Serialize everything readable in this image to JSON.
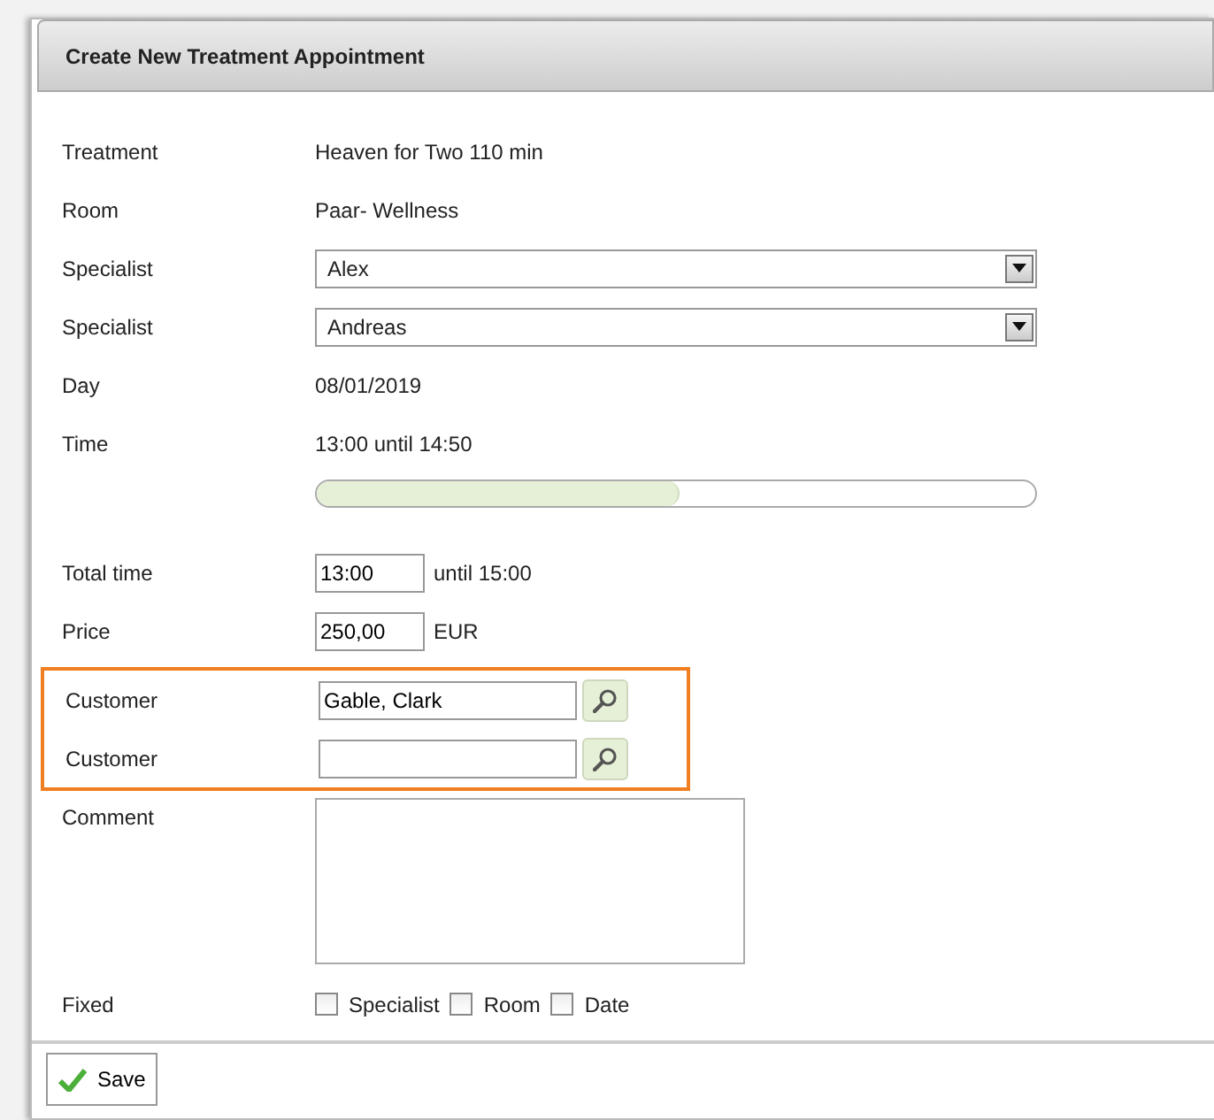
{
  "dialog": {
    "title": "Create New Treatment Appointment"
  },
  "info_rows": [
    {
      "label": "Treatment",
      "value": "Heaven for Two 110 min"
    },
    {
      "label": "Room",
      "value": "Paar- Wellness"
    }
  ],
  "specialists": [
    {
      "label": "Specialist",
      "value": "Alex"
    },
    {
      "label": "Specialist",
      "value": "Andreas"
    }
  ],
  "day": {
    "label": "Day",
    "value": "08/01/2019"
  },
  "time": {
    "label": "Time",
    "value": "13:00 until 14:50",
    "level": 0.505
  },
  "total_time": {
    "label": "Total time",
    "value": "13:00",
    "suffix": "until 15:00"
  },
  "price": {
    "label": "Price",
    "value": "250,00",
    "suffix": "EUR"
  },
  "customer_group": {
    "highlighted": true,
    "customers": [
      {
        "label": "Customer",
        "value": "Gable, Clark"
      },
      {
        "label": "Customer"
      }
    ]
  },
  "comment": {
    "label": "Comment"
  },
  "fixed": {
    "label": "Fixed",
    "options": [
      {
        "label": "Specialist",
        "checked": false
      },
      {
        "label": "Room",
        "checked": false
      },
      {
        "label": "Date",
        "checked": false
      }
    ]
  },
  "save_button": {
    "label": "Save"
  }
}
